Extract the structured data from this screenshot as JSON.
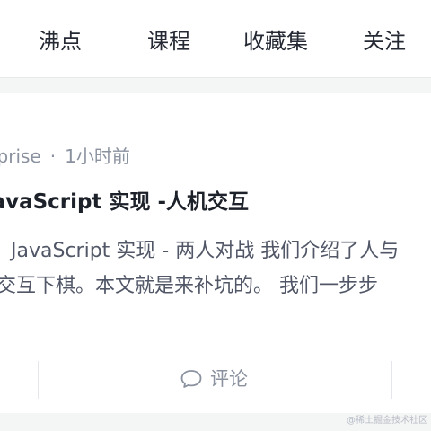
{
  "tabs": [
    {
      "label": "沸点"
    },
    {
      "label": "课程"
    },
    {
      "label": "收藏集"
    },
    {
      "label": "关注"
    }
  ],
  "article": {
    "author": "erprise",
    "separator": "·",
    "time": "1小时前",
    "title": "JavaScript 实现 -人机交互",
    "abstract_line1": "JavaScript 实现 - 两人对战 我们介绍了人与",
    "abstract_line2": "交互下棋。本文就是来补坑的。 我们一步步"
  },
  "actions": {
    "comment_label": "评论",
    "comment_icon": "chat-bubble-icon"
  },
  "watermark": "@稀土掘金技术社区",
  "colors": {
    "background": "#f4f5f5",
    "card": "#ffffff",
    "tab_text": "#252933",
    "meta_text": "#8a919f",
    "title_text": "#1d2129",
    "abstract_text": "#515767"
  }
}
